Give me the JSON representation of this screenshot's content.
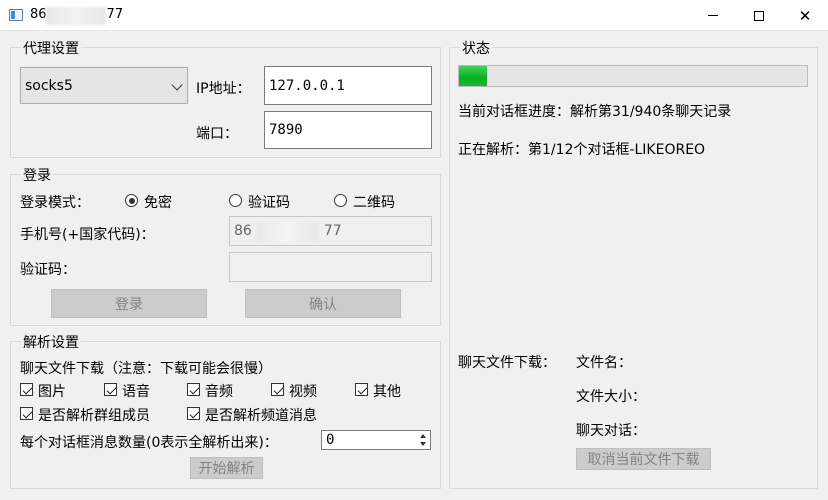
{
  "window": {
    "title_prefix": "86",
    "title_suffix": "77"
  },
  "proxy": {
    "group_title": "代理设置",
    "type_value": "socks5",
    "ip_label": "IP地址：",
    "ip_value": "127.0.0.1",
    "port_label": "端口：",
    "port_value": "7890"
  },
  "login": {
    "group_title": "登录",
    "mode_label": "登录模式：",
    "modes": [
      {
        "label": "免密",
        "checked": true
      },
      {
        "label": "验证码",
        "checked": false
      },
      {
        "label": "二维码",
        "checked": false
      }
    ],
    "phone_label": "手机号(+国家代码)：",
    "phone_prefix": "86",
    "phone_suffix": "77",
    "code_label": "验证码：",
    "code_value": "",
    "login_button": "登录",
    "confirm_button": "确认"
  },
  "parse": {
    "group_title": "解析设置",
    "download_note": "聊天文件下载（注意：下载可能会很慢）",
    "file_types": [
      {
        "label": "图片",
        "checked": true
      },
      {
        "label": "语音",
        "checked": true
      },
      {
        "label": "音频",
        "checked": true
      },
      {
        "label": "视频",
        "checked": true
      },
      {
        "label": "其他",
        "checked": true
      }
    ],
    "parse_members_label": "是否解析群组成员",
    "parse_members_checked": true,
    "parse_channel_label": "是否解析频道消息",
    "parse_channel_checked": true,
    "count_label": "每个对话框消息数量(0表示全解析出来)：",
    "count_value": "0",
    "start_button": "开始解析"
  },
  "status": {
    "group_title": "状态",
    "progress": 0.08,
    "dialog_progress": "当前对话框进度：解析第31/940条聊天记录",
    "parsing": "正在解析：第1/12个对话框-LIKEOREO",
    "download_label": "聊天文件下载：",
    "file_name_label": "文件名：",
    "file_size_label": "文件大小：",
    "chat_label": "聊天对话：",
    "cancel_button": "取消当前文件下载"
  },
  "colors": {
    "progress_fill": "#06b025",
    "background": "#f0f0f0"
  },
  "icons": {
    "app": "app-window-icon",
    "minimize": "minimize-icon",
    "maximize": "maximize-icon",
    "close": "close-icon",
    "dropdown": "chevron-down-icon"
  }
}
